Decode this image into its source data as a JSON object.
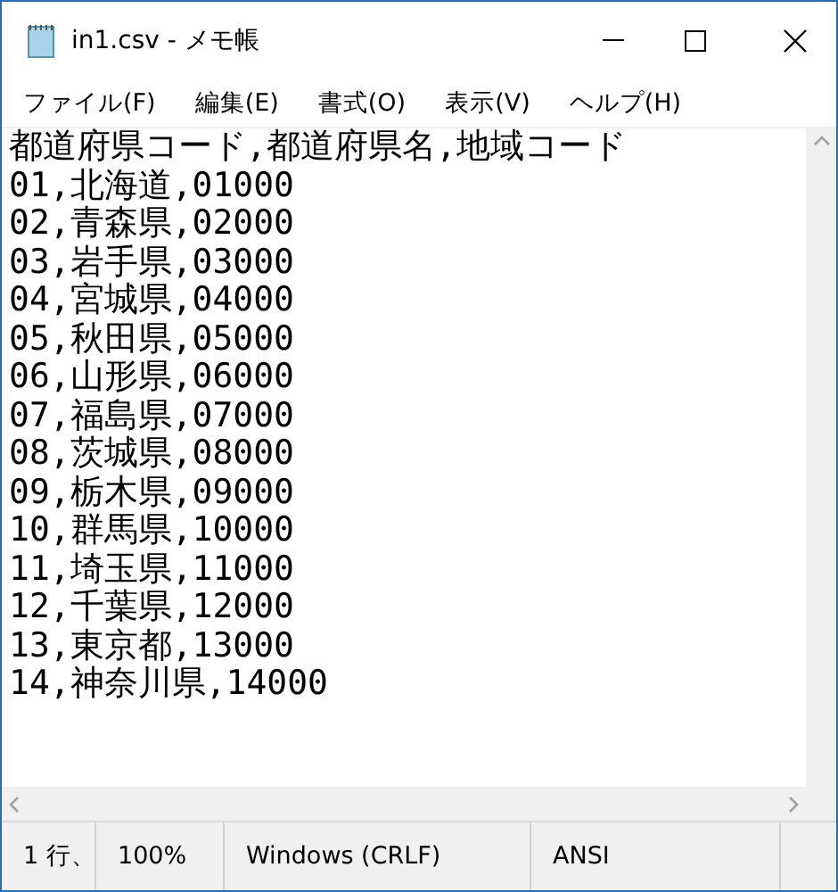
{
  "window": {
    "title": "in1.csv - メモ帳"
  },
  "menu": [
    "ファイル(F)",
    "編集(E)",
    "書式(O)",
    "表示(V)",
    "ヘルプ(H)"
  ],
  "editor": {
    "lines": [
      "都道府県コード,都道府県名,地域コード",
      "01,北海道,01000",
      "02,青森県,02000",
      "03,岩手県,03000",
      "04,宮城県,04000",
      "05,秋田県,05000",
      "06,山形県,06000",
      "07,福島県,07000",
      "08,茨城県,08000",
      "09,栃木県,09000",
      "10,群馬県,10000",
      "11,埼玉県,11000",
      "12,千葉県,12000",
      "13,東京都,13000",
      "14,神奈川県,14000"
    ]
  },
  "status_bar": [
    "1 行、",
    "100%",
    "Windows (CRLF)",
    "ANSI"
  ]
}
